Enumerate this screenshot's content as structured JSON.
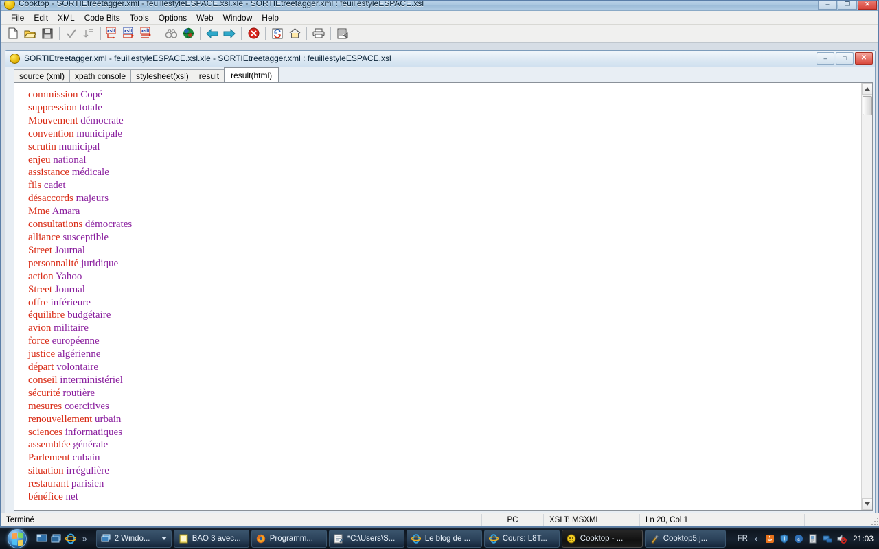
{
  "window": {
    "title": "Cooktop - SORTIEtreetagger.xml - feuillestyleESPACE.xsl.xle - SORTIEtreetagger.xml : feuillestyleESPACE.xsl",
    "app_icon": "cooktop-icon",
    "controls": {
      "minimize": "–",
      "restore": "❐",
      "close": "✕"
    }
  },
  "menubar": {
    "items": [
      {
        "label": "File"
      },
      {
        "label": "Edit"
      },
      {
        "label": "XML"
      },
      {
        "label": "Code Bits"
      },
      {
        "label": "Tools"
      },
      {
        "label": "Options"
      },
      {
        "label": "Web"
      },
      {
        "label": "Window"
      },
      {
        "label": "Help"
      }
    ]
  },
  "toolbar": {
    "buttons": [
      {
        "name": "new-file-icon",
        "kind": "page"
      },
      {
        "name": "open-folder-icon",
        "kind": "folder"
      },
      {
        "name": "save-icon",
        "kind": "floppy"
      },
      {
        "name": "sep",
        "kind": "sep"
      },
      {
        "name": "check-validate-icon",
        "kind": "check"
      },
      {
        "name": "format-indent-icon",
        "kind": "indent"
      },
      {
        "name": "sep",
        "kind": "sep"
      },
      {
        "name": "xslt-transform-icon",
        "kind": "xslt",
        "text": "xslt"
      },
      {
        "name": "xslt-result-icon",
        "kind": "xslt2",
        "text": "xslt"
      },
      {
        "name": "xslt-html-icon",
        "kind": "xslt3",
        "text": "xslt"
      },
      {
        "name": "sep",
        "kind": "sep"
      },
      {
        "name": "find-binoculars-icon",
        "kind": "binoculars"
      },
      {
        "name": "browser-globe-icon",
        "kind": "globe"
      },
      {
        "name": "sep",
        "kind": "sep"
      },
      {
        "name": "back-arrow-icon",
        "kind": "back"
      },
      {
        "name": "forward-arrow-icon",
        "kind": "forward"
      },
      {
        "name": "sep",
        "kind": "sep"
      },
      {
        "name": "stop-icon",
        "kind": "stop"
      },
      {
        "name": "sep",
        "kind": "sep"
      },
      {
        "name": "refresh-icon",
        "kind": "refresh"
      },
      {
        "name": "home-icon",
        "kind": "home"
      },
      {
        "name": "sep",
        "kind": "sep"
      },
      {
        "name": "print-icon",
        "kind": "print"
      },
      {
        "name": "sep",
        "kind": "sep"
      },
      {
        "name": "properties-icon",
        "kind": "props"
      }
    ]
  },
  "child_window": {
    "title": "SORTIEtreetagger.xml - feuillestyleESPACE.xsl.xle - SORTIEtreetagger.xml : feuillestyleESPACE.xsl",
    "icon": "cooktop-doc-icon",
    "controls": {
      "minimize": "–",
      "restore": "□",
      "close": "✕"
    },
    "tabs": [
      {
        "label": "source (xml)",
        "active": false
      },
      {
        "label": "xpath console",
        "active": false
      },
      {
        "label": "stylesheet(xsl)",
        "active": false
      },
      {
        "label": "result",
        "active": false
      },
      {
        "label": "result(html)",
        "active": true
      }
    ]
  },
  "result": {
    "colors": {
      "word1": "#d92b15",
      "word2": "#8a1f9e"
    },
    "lines": [
      {
        "w1": "commission",
        "w2": "Copé"
      },
      {
        "w1": "suppression",
        "w2": "totale"
      },
      {
        "w1": "Mouvement",
        "w2": "démocrate"
      },
      {
        "w1": "convention",
        "w2": "municipale"
      },
      {
        "w1": "scrutin",
        "w2": "municipal"
      },
      {
        "w1": "enjeu",
        "w2": "national"
      },
      {
        "w1": "assistance",
        "w2": "médicale"
      },
      {
        "w1": "fils",
        "w2": "cadet"
      },
      {
        "w1": "désaccords",
        "w2": "majeurs"
      },
      {
        "w1": "Mme",
        "w2": "Amara"
      },
      {
        "w1": "consultations",
        "w2": "démocrates"
      },
      {
        "w1": "alliance",
        "w2": "susceptible"
      },
      {
        "w1": "Street",
        "w2": "Journal"
      },
      {
        "w1": "personnalité",
        "w2": "juridique"
      },
      {
        "w1": "action",
        "w2": "Yahoo"
      },
      {
        "w1": "Street",
        "w2": "Journal"
      },
      {
        "w1": "offre",
        "w2": "inférieure"
      },
      {
        "w1": "équilibre",
        "w2": "budgétaire"
      },
      {
        "w1": "avion",
        "w2": "militaire"
      },
      {
        "w1": "force",
        "w2": "européenne"
      },
      {
        "w1": "justice",
        "w2": "algérienne"
      },
      {
        "w1": "départ",
        "w2": "volontaire"
      },
      {
        "w1": "conseil",
        "w2": "interministériel"
      },
      {
        "w1": "sécurité",
        "w2": "routière"
      },
      {
        "w1": "mesures",
        "w2": "coercitives"
      },
      {
        "w1": "renouvellement",
        "w2": "urbain"
      },
      {
        "w1": "sciences",
        "w2": "informatiques"
      },
      {
        "w1": "assemblée",
        "w2": "générale"
      },
      {
        "w1": "Parlement",
        "w2": "cubain"
      },
      {
        "w1": "situation",
        "w2": "irrégulière"
      },
      {
        "w1": "restaurant",
        "w2": "parisien"
      },
      {
        "w1": "bénéfice",
        "w2": "net"
      }
    ]
  },
  "statusbar": {
    "message": "Terminé",
    "platform": "PC",
    "processor": "XSLT: MSXML",
    "caret": "Ln 20, Col 1"
  },
  "taskbar": {
    "start_label": "start-orb",
    "quicklaunch": [
      {
        "name": "show-desktop-icon"
      },
      {
        "name": "switch-windows-icon"
      },
      {
        "name": "internet-explorer-icon"
      }
    ],
    "chevron": "»",
    "buttons": [
      {
        "label": "2 Windo...",
        "icon": "window-group-icon",
        "active": false,
        "group": true
      },
      {
        "label": "BAO 3 avec...",
        "icon": "document-icon",
        "active": false,
        "group": false
      },
      {
        "label": "Programm...",
        "icon": "firefox-icon",
        "active": false,
        "group": false
      },
      {
        "label": "*C:\\Users\\S...",
        "icon": "notepad-icon",
        "active": false,
        "group": false
      },
      {
        "label": "Le blog de ...",
        "icon": "internet-explorer-icon",
        "active": false,
        "group": false
      },
      {
        "label": "Cours: L8T...",
        "icon": "internet-explorer-icon",
        "active": false,
        "group": false
      },
      {
        "label": "Cooktop - ...",
        "icon": "cooktop-icon",
        "active": true,
        "group": false
      },
      {
        "label": "Cooktop5.j...",
        "icon": "installer-icon",
        "active": false,
        "group": false
      }
    ],
    "tray": {
      "language": "FR",
      "chevron": "‹",
      "icons": [
        {
          "name": "java-tray-icon"
        },
        {
          "name": "antivirus-tray-icon"
        },
        {
          "name": "adobe-tray-icon"
        },
        {
          "name": "device-tray-icon"
        },
        {
          "name": "network-tray-icon"
        },
        {
          "name": "volume-muted-tray-icon"
        }
      ],
      "clock": "21:03"
    }
  }
}
